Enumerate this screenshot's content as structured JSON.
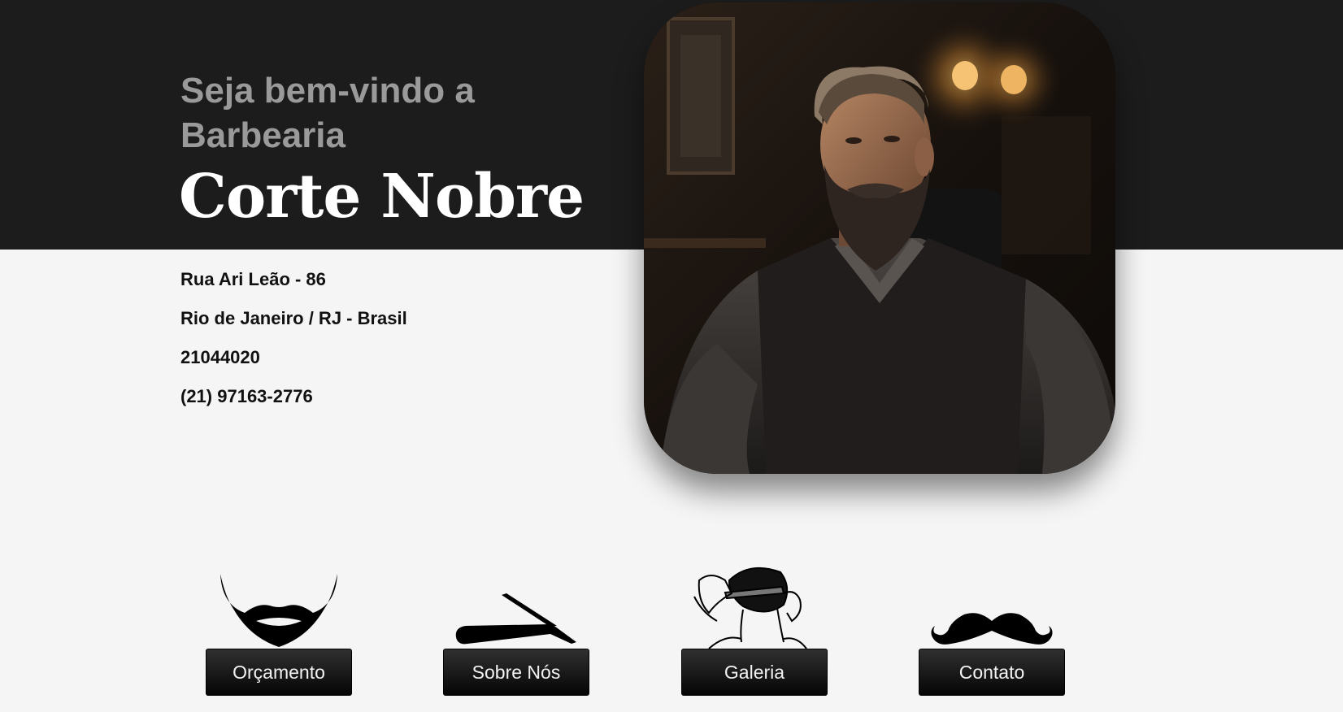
{
  "hero": {
    "welcome_text": "Seja bem-vindo a Barbearia",
    "brand_name": "Corte Nobre",
    "band_color": "#1c1c1c"
  },
  "address": {
    "street": "Rua Ari Leão - 86",
    "city": "Rio de Janeiro / RJ - Brasil",
    "postal_code": "21044020",
    "phone": "(21) 97163-2776"
  },
  "photo": {
    "subject": "bearded-man-in-barber-chair"
  },
  "services": [
    {
      "icon": "beard-icon",
      "label": "Orçamento"
    },
    {
      "icon": "straight-razor-icon",
      "label": "Sobre Nós"
    },
    {
      "icon": "haircut-icon",
      "label": "Galeria"
    },
    {
      "icon": "mustache-icon",
      "label": "Contato"
    }
  ]
}
